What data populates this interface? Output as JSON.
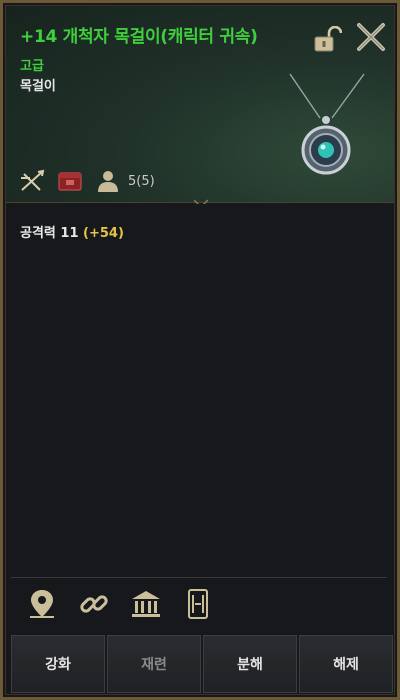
{
  "item": {
    "title": "+14 개척자 목걸이(캐릭터 귀속)",
    "grade": "고급",
    "type": "목걸이",
    "bind_count": "5(5)"
  },
  "stats": {
    "attack_label": "공격력 11",
    "attack_bonus": "(+54)"
  },
  "icons": {
    "header": [
      "lock-open-icon",
      "close-icon",
      "necklace-item-icon",
      "crossbow-class-icon",
      "storage-chest-icon",
      "bound-character-icon"
    ],
    "bottom": [
      "location-pin-icon",
      "link-chain-icon",
      "bank-icon",
      "scroll-gate-icon"
    ]
  },
  "buttons": {
    "enhance": "강화",
    "material": "재련",
    "disassemble": "분해",
    "unequip": "해제"
  },
  "colors": {
    "title_green": "#3fcf3c",
    "bonus_gold": "#e6c24a",
    "frame_gold": "#6b5a35"
  }
}
